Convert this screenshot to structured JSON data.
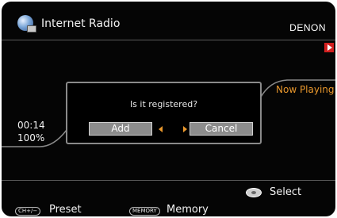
{
  "header": {
    "app_icon": "internet-radio-globe-icon",
    "title": "Internet Radio",
    "brand": "DENON"
  },
  "status": {
    "play_indicator_icon": "play-icon",
    "now_playing": "Now Playing",
    "time": "00:14",
    "buffer": "100%"
  },
  "dialog": {
    "prompt": "Is it registered?",
    "add_label": "Add",
    "cancel_label": "Cancel",
    "selected": "Add"
  },
  "footer": {
    "select_icon": "select-dial-icon",
    "select_label": "Select",
    "preset_key": "CH+/−",
    "preset_label": "Preset",
    "memory_key": "MEMORY",
    "memory_label": "Memory"
  },
  "colors": {
    "background": "#050505",
    "accent": "#e8972c",
    "indicator": "#d21f1f",
    "button": "#8c8c8c"
  }
}
